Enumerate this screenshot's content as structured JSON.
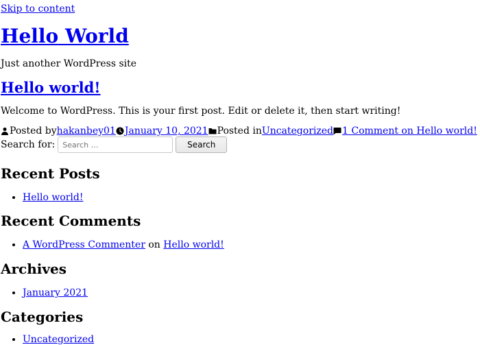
{
  "skip_link": "Skip to content",
  "site": {
    "title": "Hello World",
    "tagline": "Just another WordPress site"
  },
  "post": {
    "title": "Hello world!",
    "excerpt": "Welcome to WordPress. This is your first post. Edit or delete it, then start writing!",
    "meta": {
      "posted_by_label": "Posted by",
      "author": "hakanbey01",
      "date": "January 10, 2021",
      "posted_in_label": "Posted in",
      "category": "Uncategorized",
      "comments": "1 Comment on Hello world!"
    }
  },
  "search": {
    "label": "Search for:",
    "placeholder": "Search …",
    "button": "Search"
  },
  "widgets": {
    "recent_posts": {
      "title": "Recent Posts",
      "items": [
        "Hello world!"
      ]
    },
    "recent_comments": {
      "title": "Recent Comments",
      "commenter": "A WordPress Commenter",
      "on_word": "on",
      "post": "Hello world!"
    },
    "archives": {
      "title": "Archives",
      "items": [
        "January 2021"
      ]
    },
    "categories": {
      "title": "Categories",
      "items": [
        "Uncategorized"
      ]
    }
  },
  "colors": {
    "link": "#0000ee",
    "text": "#000000",
    "background": "#ffffff"
  }
}
